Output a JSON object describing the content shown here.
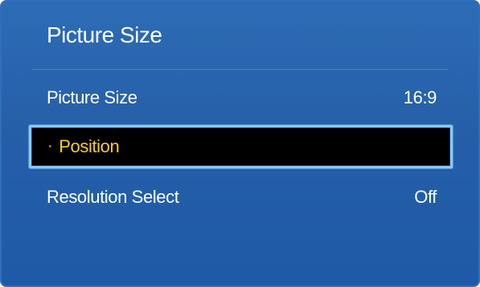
{
  "menu": {
    "title": "Picture Size",
    "items": [
      {
        "label": "Picture Size",
        "value": "16:9"
      },
      {
        "label": "Position",
        "bullet": "·",
        "value": ""
      },
      {
        "label": "Resolution Select",
        "value": "Off"
      }
    ]
  },
  "colors": {
    "panel_blue": "#255fa8",
    "selected_text": "#ffcc1e",
    "highlight_border": "#8ac8ff"
  }
}
